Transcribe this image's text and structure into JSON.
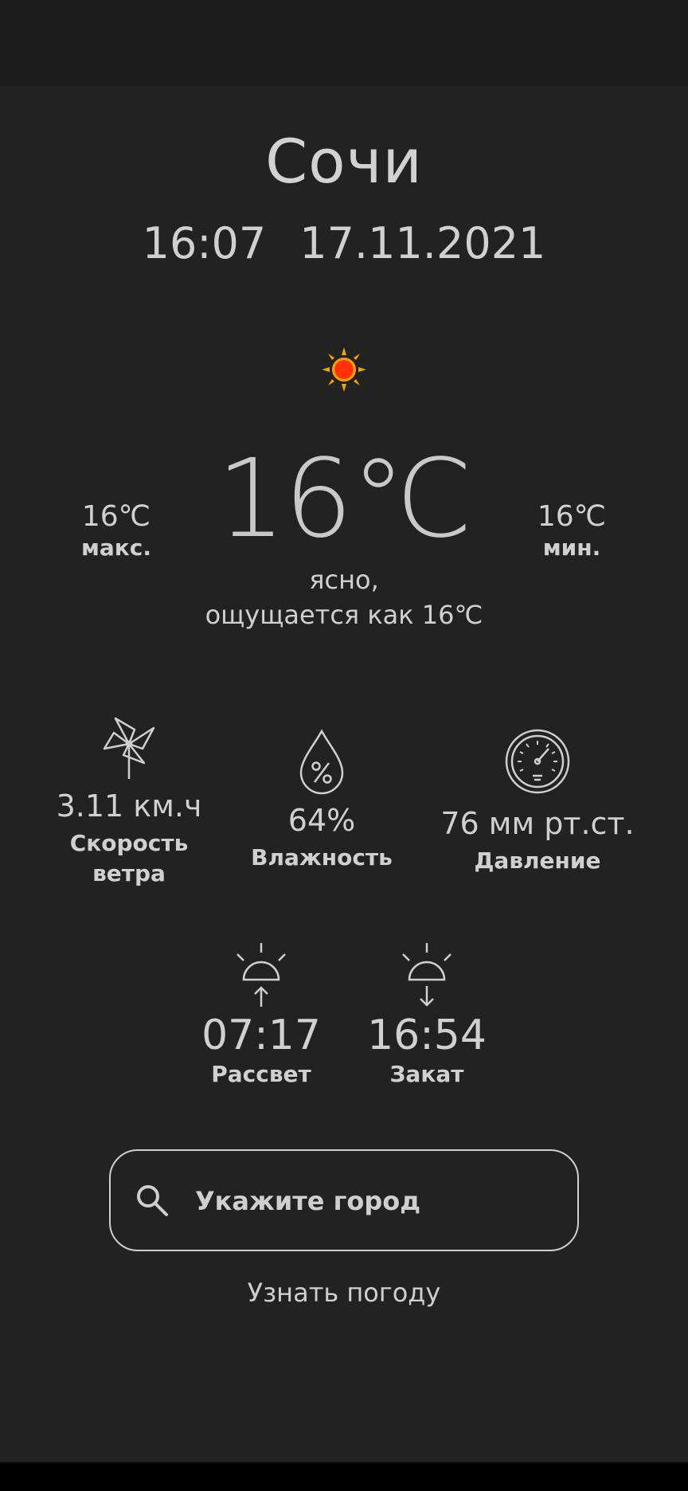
{
  "header": {
    "city": "Сочи",
    "time": "16:07",
    "date": "17.11.2021"
  },
  "weather": {
    "icon": "sun-icon",
    "temperature": "16℃",
    "max_value": "16℃",
    "max_label": "макс.",
    "min_value": "16℃",
    "min_label": "мин.",
    "description": "ясно,",
    "feels_like": "ощущается как 16℃"
  },
  "metrics": {
    "wind": {
      "icon": "pinwheel-icon",
      "value": "3.11 км.ч",
      "label_line1": "Скорость",
      "label_line2": "ветра"
    },
    "humidity": {
      "icon": "drop-percent-icon",
      "value": "64%",
      "label": "Влажность"
    },
    "pressure": {
      "icon": "gauge-icon",
      "value": "76 мм рт.ст.",
      "label": "Давление"
    }
  },
  "sun": {
    "sunrise": {
      "icon": "sunrise-icon",
      "time": "07:17",
      "label": "Рассвет"
    },
    "sunset": {
      "icon": "sunset-icon",
      "time": "16:54",
      "label": "Закат"
    }
  },
  "search": {
    "placeholder": "Укажите город",
    "value": ""
  },
  "action": {
    "label": "Узнать погоду"
  },
  "colors": {
    "background": "#222222",
    "text": "#d0d0d0",
    "status_bar": "#1c1c1c",
    "sun": "#ff3b00"
  }
}
